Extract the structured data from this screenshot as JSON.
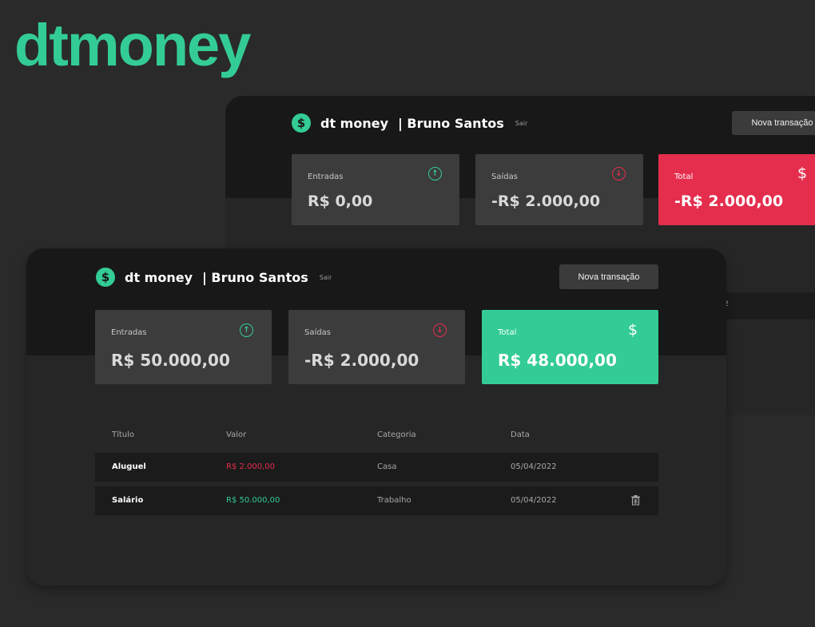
{
  "brand": "dtmoney",
  "colors": {
    "accent_green": "#33cc95",
    "accent_red": "#e52e4d",
    "background": "#2a2a2a",
    "header": "#181818",
    "card": "#3c3c3c"
  },
  "back_window": {
    "header": {
      "logo_icon": "dollar-coin-icon",
      "logo_symbol": "$",
      "app_name": "dt money",
      "user_name": "| Bruno Santos",
      "logout": "Sair",
      "new_transaction": "Nova transação"
    },
    "summary": {
      "income": {
        "label": "Entradas",
        "value": "R$ 0,00",
        "icon": "arrow-up-circle-icon",
        "icon_glyph": "↑"
      },
      "outcome": {
        "label": "Saídas",
        "value": "-R$ 2.000,00",
        "icon": "arrow-down-circle-icon",
        "icon_glyph": "↓"
      },
      "total": {
        "label": "Total",
        "value": "-R$ 2.000,00",
        "icon": "dollar-icon",
        "icon_glyph": "$",
        "color": "#e52e4d"
      }
    },
    "partial_row_text": "2"
  },
  "front_window": {
    "header": {
      "logo_icon": "dollar-coin-icon",
      "logo_symbol": "$",
      "app_name": "dt money",
      "user_name": "| Bruno Santos",
      "logout": "Sair",
      "new_transaction": "Nova transação"
    },
    "summary": {
      "income": {
        "label": "Entradas",
        "value": "R$ 50.000,00",
        "icon": "arrow-up-circle-icon",
        "icon_glyph": "↑"
      },
      "outcome": {
        "label": "Saídas",
        "value": "-R$ 2.000,00",
        "icon": "arrow-down-circle-icon",
        "icon_glyph": "↓"
      },
      "total": {
        "label": "Total",
        "value": "R$ 48.000,00",
        "icon": "dollar-icon",
        "icon_glyph": "$",
        "color": "#33cc95"
      }
    },
    "table": {
      "columns": [
        "Título",
        "Valor",
        "Categoria",
        "Data"
      ],
      "rows": [
        {
          "title": "Aluguel",
          "value": "R$ 2.000,00",
          "type": "outcome",
          "category": "Casa",
          "date": "05/04/2022",
          "trash": false
        },
        {
          "title": "Salário",
          "value": "R$ 50.000,00",
          "type": "income",
          "category": "Trabalho",
          "date": "05/04/2022",
          "trash": true
        }
      ]
    }
  }
}
